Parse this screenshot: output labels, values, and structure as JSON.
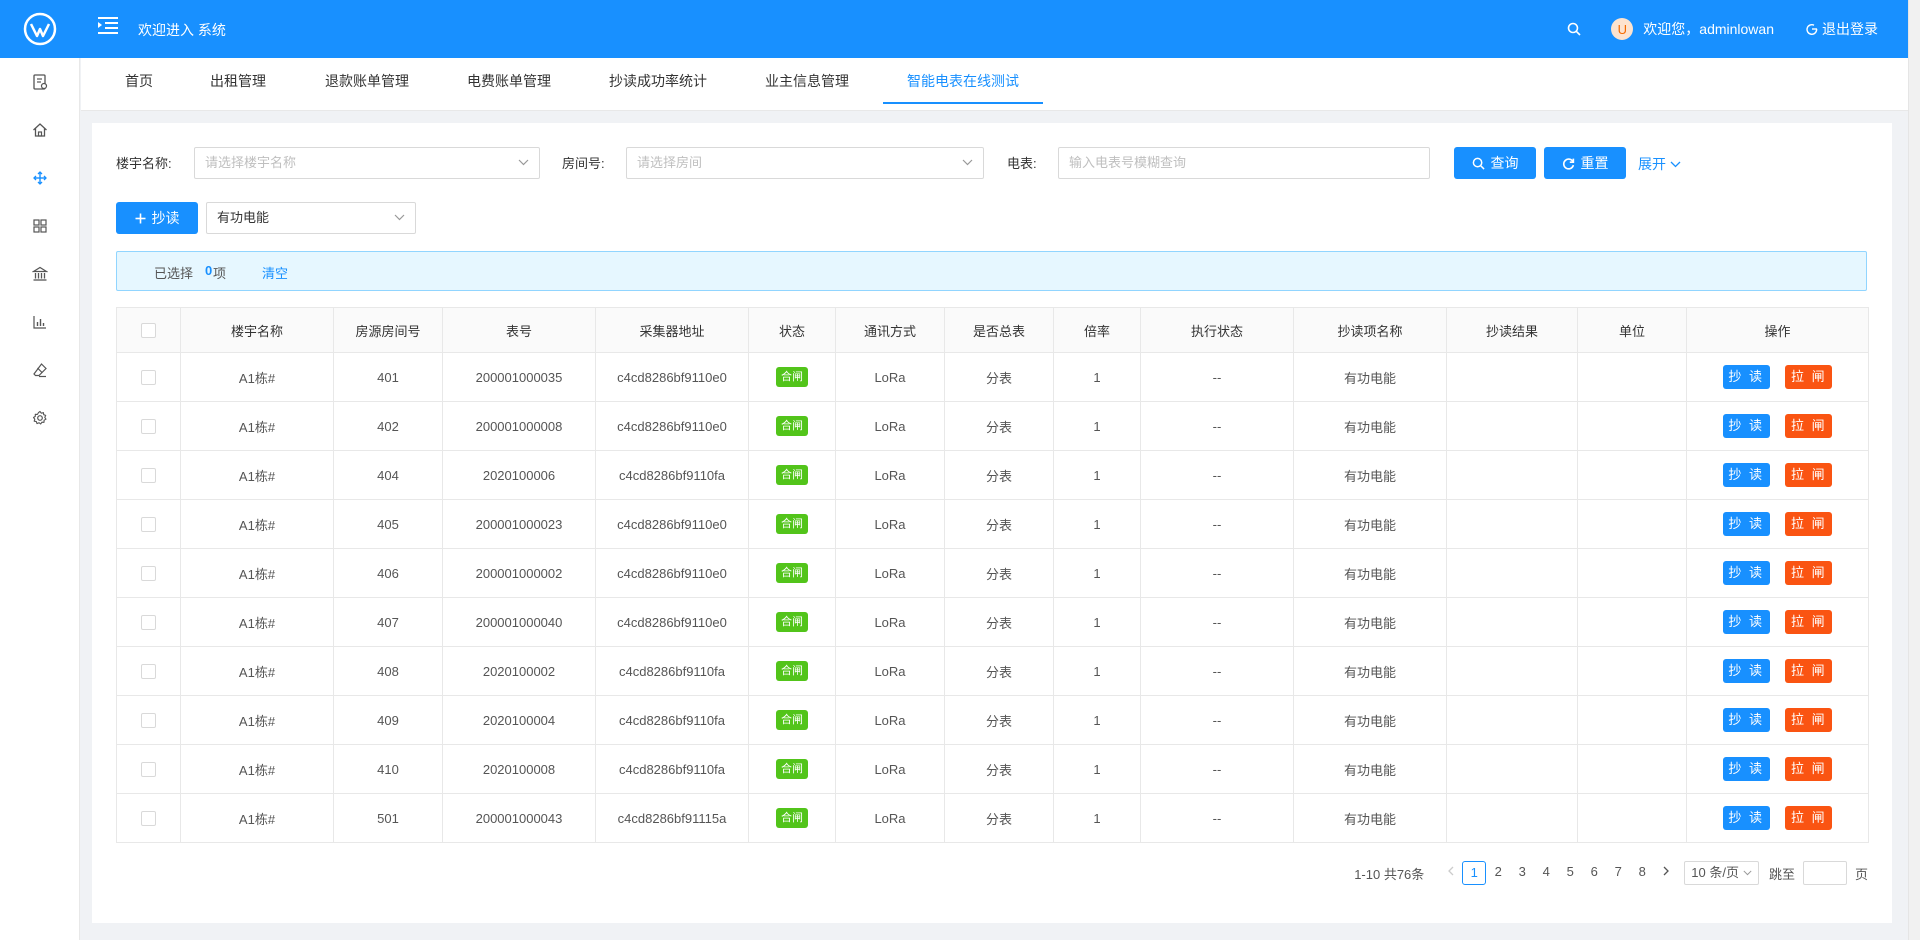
{
  "header": {
    "title": "欢迎进入 系统",
    "welcome": "欢迎您，adminlowan",
    "avatar_letter": "U",
    "logout": "退出登录"
  },
  "sidebar": {
    "icons": [
      "bill-icon",
      "home-icon",
      "move-icon",
      "grid-icon",
      "bank-icon",
      "bar-chart-icon",
      "eraser-icon",
      "settings-icon"
    ],
    "active_index": 2
  },
  "tabs": [
    {
      "label": "首页"
    },
    {
      "label": "出租管理"
    },
    {
      "label": "退款账单管理"
    },
    {
      "label": "电费账单管理"
    },
    {
      "label": "抄读成功率统计"
    },
    {
      "label": "业主信息管理"
    },
    {
      "label": "智能电表在线测试",
      "active": true
    }
  ],
  "search": {
    "building_label": "楼宇名称:",
    "building_placeholder": "请选择楼宇名称",
    "room_label": "房间号:",
    "room_placeholder": "请选择房间",
    "meter_label": "电表:",
    "meter_placeholder": "输入电表号模糊查询",
    "query_button": "查询",
    "reset_button": "重置",
    "expand_link": "展开"
  },
  "toolbar": {
    "read_button": "抄读",
    "energy_select": "有功电能"
  },
  "selection": {
    "prefix": "已选择",
    "count": "0",
    "suffix": "项",
    "clear": "清空"
  },
  "table": {
    "columns": [
      "楼宇名称",
      "房源房间号",
      "表号",
      "采集器地址",
      "状态",
      "通讯方式",
      "是否总表",
      "倍率",
      "执行状态",
      "抄读项名称",
      "抄读结果",
      "单位",
      "操作"
    ],
    "read_action": "抄 读",
    "pull_action": "拉 闸",
    "rows": [
      {
        "building": "A1栋#",
        "room": "401",
        "meter": "200001000035",
        "collector": "c4cd8286bf9110e0",
        "status": "合闸",
        "comm": "LoRa",
        "total": "分表",
        "rate": "1",
        "exec": "--",
        "item": "有功电能",
        "result": "",
        "unit": ""
      },
      {
        "building": "A1栋#",
        "room": "402",
        "meter": "200001000008",
        "collector": "c4cd8286bf9110e0",
        "status": "合闸",
        "comm": "LoRa",
        "total": "分表",
        "rate": "1",
        "exec": "--",
        "item": "有功电能",
        "result": "",
        "unit": ""
      },
      {
        "building": "A1栋#",
        "room": "404",
        "meter": "2020100006",
        "collector": "c4cd8286bf9110fa",
        "status": "合闸",
        "comm": "LoRa",
        "total": "分表",
        "rate": "1",
        "exec": "--",
        "item": "有功电能",
        "result": "",
        "unit": ""
      },
      {
        "building": "A1栋#",
        "room": "405",
        "meter": "200001000023",
        "collector": "c4cd8286bf9110e0",
        "status": "合闸",
        "comm": "LoRa",
        "total": "分表",
        "rate": "1",
        "exec": "--",
        "item": "有功电能",
        "result": "",
        "unit": ""
      },
      {
        "building": "A1栋#",
        "room": "406",
        "meter": "200001000002",
        "collector": "c4cd8286bf9110e0",
        "status": "合闸",
        "comm": "LoRa",
        "total": "分表",
        "rate": "1",
        "exec": "--",
        "item": "有功电能",
        "result": "",
        "unit": ""
      },
      {
        "building": "A1栋#",
        "room": "407",
        "meter": "200001000040",
        "collector": "c4cd8286bf9110e0",
        "status": "合闸",
        "comm": "LoRa",
        "total": "分表",
        "rate": "1",
        "exec": "--",
        "item": "有功电能",
        "result": "",
        "unit": ""
      },
      {
        "building": "A1栋#",
        "room": "408",
        "meter": "2020100002",
        "collector": "c4cd8286bf9110fa",
        "status": "合闸",
        "comm": "LoRa",
        "total": "分表",
        "rate": "1",
        "exec": "--",
        "item": "有功电能",
        "result": "",
        "unit": ""
      },
      {
        "building": "A1栋#",
        "room": "409",
        "meter": "2020100004",
        "collector": "c4cd8286bf9110fa",
        "status": "合闸",
        "comm": "LoRa",
        "total": "分表",
        "rate": "1",
        "exec": "--",
        "item": "有功电能",
        "result": "",
        "unit": ""
      },
      {
        "building": "A1栋#",
        "room": "410",
        "meter": "2020100008",
        "collector": "c4cd8286bf9110fa",
        "status": "合闸",
        "comm": "LoRa",
        "total": "分表",
        "rate": "1",
        "exec": "--",
        "item": "有功电能",
        "result": "",
        "unit": ""
      },
      {
        "building": "A1栋#",
        "room": "501",
        "meter": "200001000043",
        "collector": "c4cd8286bf91115a",
        "status": "合闸",
        "comm": "LoRa",
        "total": "分表",
        "rate": "1",
        "exec": "--",
        "item": "有功电能",
        "result": "",
        "unit": ""
      }
    ]
  },
  "pagination": {
    "total_text": "1-10 共76条",
    "pages": [
      "1",
      "2",
      "3",
      "4",
      "5",
      "6",
      "7",
      "8"
    ],
    "current": "1",
    "page_size": "10 条/页",
    "jump_prefix": "跳至",
    "jump_suffix": "页"
  },
  "colors": {
    "primary": "#1890ff",
    "status_green": "#52c41a",
    "pull_orange": "#fa5412"
  }
}
